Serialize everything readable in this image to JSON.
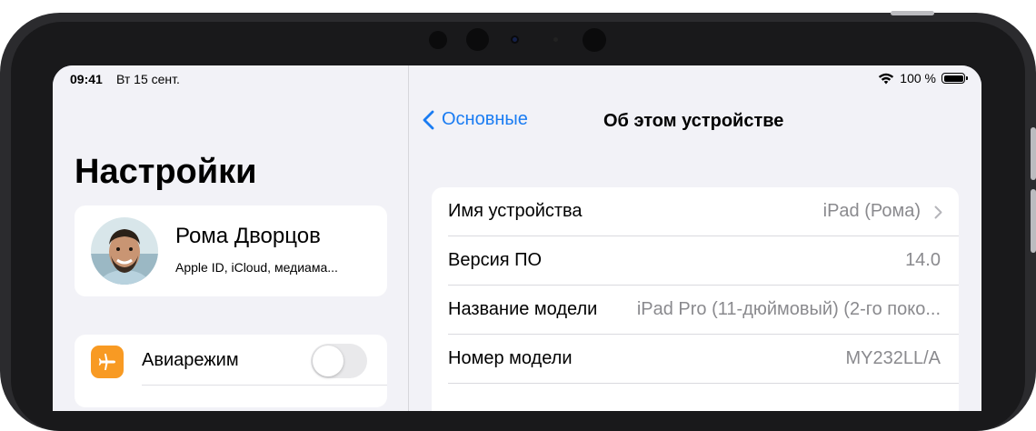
{
  "status_bar": {
    "time": "09:41",
    "date": "Вт 15 сент.",
    "battery_percent": "100 %"
  },
  "sidebar": {
    "title": "Настройки",
    "profile": {
      "name": "Рома Дворцов",
      "subtitle": "Apple ID, iCloud, медиама..."
    },
    "items": [
      {
        "label": "Авиарежим",
        "icon": "airplane-icon",
        "toggle_on": false
      }
    ]
  },
  "detail": {
    "back_label": "Основные",
    "title": "Об этом устройстве",
    "rows": [
      {
        "label": "Имя устройства",
        "value": "iPad (Рома)",
        "has_chevron": true
      },
      {
        "label": "Версия ПО",
        "value": "14.0"
      },
      {
        "label": "Название модели",
        "value": "iPad Pro (11-дюймовый) (2-го поко..."
      },
      {
        "label": "Номер модели",
        "value": "MY232LL/A"
      }
    ]
  },
  "colors": {
    "accent": "#1a7cf2",
    "airplane_icon_bg": "#f89a23",
    "grouped_background": "#f2f2f7",
    "secondary_text": "#8a8a8e"
  }
}
